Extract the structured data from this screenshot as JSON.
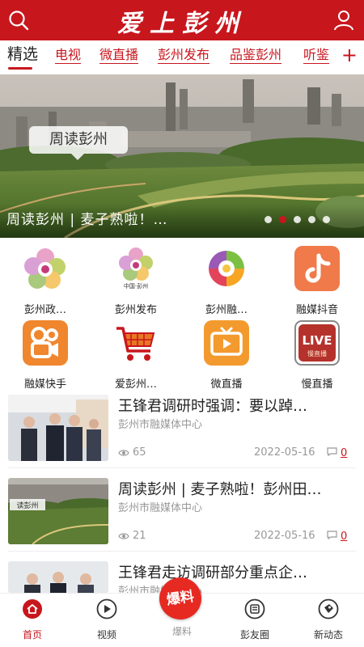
{
  "header": {
    "logo_text": "爱上彭州",
    "search_icon": "search-icon",
    "user_icon": "user-icon",
    "accent": "#c8161d"
  },
  "tabs": {
    "items": [
      {
        "label": "精选"
      },
      {
        "label": "电视"
      },
      {
        "label": "微直播"
      },
      {
        "label": "彭州发布"
      },
      {
        "label": "品鉴彭州"
      },
      {
        "label": "听鉴"
      }
    ],
    "add_label": "+"
  },
  "banner": {
    "stamp": "周读彭州",
    "caption": "周读彭州 | 麦子熟啦！…",
    "slide_count": 5,
    "active_slide": 1
  },
  "grid": {
    "items": [
      {
        "label": "彭州政…",
        "icon": "flower-logo-icon"
      },
      {
        "label": "彭州发布",
        "icon": "flower-logo-icon"
      },
      {
        "label": "彭州融…",
        "icon": "swirl-logo-icon"
      },
      {
        "label": "融媒抖音",
        "icon": "douyin-icon"
      },
      {
        "label": "融媒快手",
        "icon": "kuaishou-icon"
      },
      {
        "label": "爱彭州…",
        "icon": "shopping-cart-icon"
      },
      {
        "label": "微直播",
        "icon": "tv-play-icon"
      },
      {
        "label": "慢直播",
        "icon": "live-icon"
      }
    ],
    "live_badge": "LIVE",
    "live_sub": "慢直播",
    "cn_pengzhou": "中国·彭州"
  },
  "news": [
    {
      "title": "王锋君调研时强调：要以踔…",
      "source": "彭州市融媒体中心",
      "views": "65",
      "date": "2022-05-16",
      "comments": "0"
    },
    {
      "title": "周读彭州 | 麦子熟啦！彭州田…",
      "source": "彭州市融媒体中心",
      "views": "21",
      "date": "2022-05-16",
      "comments": "0",
      "thumb_tag": "读彭州"
    },
    {
      "title": "王锋君走访调研部分重点企…",
      "source": "彭州市融媒体中心"
    }
  ],
  "bottom_nav": {
    "items": [
      {
        "label": "首页",
        "icon": "home-icon"
      },
      {
        "label": "视频",
        "icon": "play-icon"
      },
      {
        "label": "爆料",
        "icon": "baoliao-icon"
      },
      {
        "label": "彭友圈",
        "icon": "circle-icon"
      },
      {
        "label": "新动态",
        "icon": "tag-icon"
      }
    ],
    "baoliao_badge": "爆料"
  }
}
